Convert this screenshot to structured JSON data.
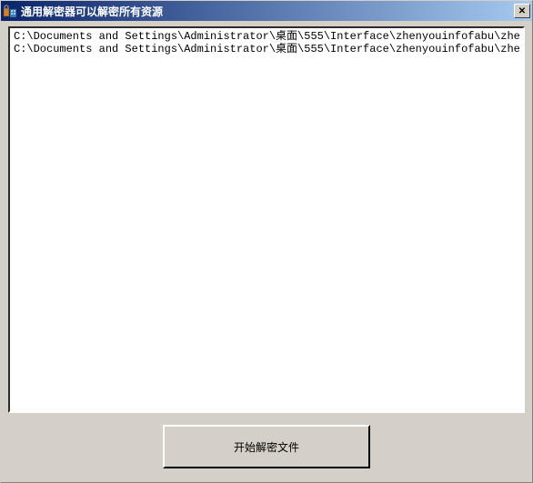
{
  "titlebar": {
    "title": "通用解密器可以解密所有资源",
    "close_symbol": "✕"
  },
  "content": {
    "lines": [
      "C:\\Documents and Settings\\Administrator\\桌面\\555\\Interface\\zhenyouinfofabu\\zhengyouinfofabu.",
      "C:\\Documents and Settings\\Administrator\\桌面\\555\\Interface\\zhenyouinfofabu\\zhengyouinfofabu."
    ]
  },
  "button": {
    "label": "开始解密文件"
  }
}
